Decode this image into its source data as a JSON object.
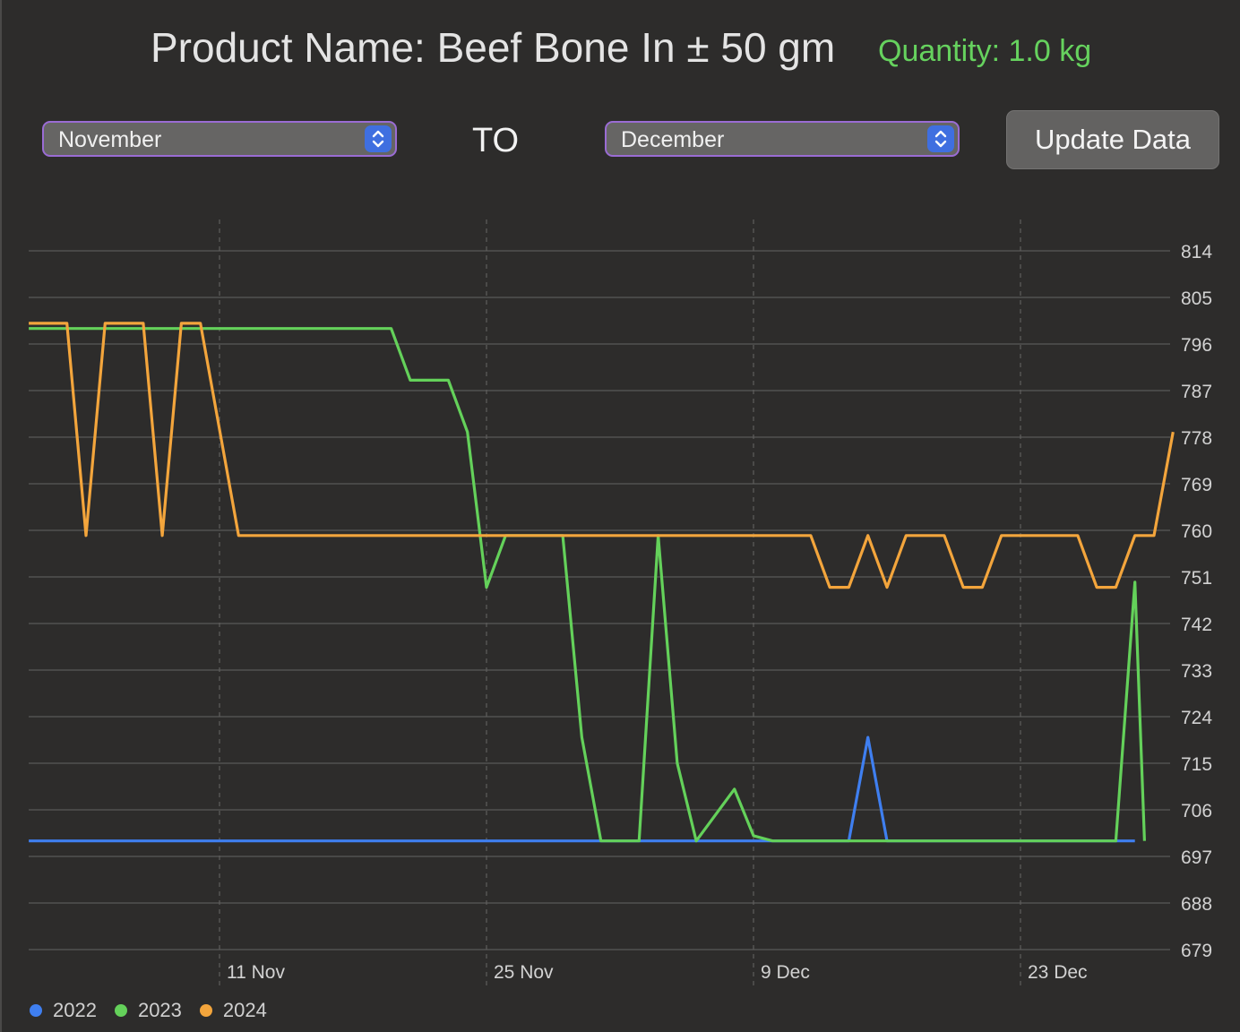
{
  "header": {
    "title": "Product Name: Beef Bone In ± 50 gm",
    "quantity": "Quantity: 1.0 kg"
  },
  "controls": {
    "from_month": "November",
    "to_label": "TO",
    "to_month": "December",
    "update_label": "Update Data"
  },
  "colors": {
    "2022": "#3f7ff0",
    "2023": "#64d15a",
    "2024": "#f3a53c",
    "accent": "#9a6cd4",
    "quantity": "#66d25e"
  },
  "chart_data": {
    "type": "line",
    "title": "",
    "xlabel": "",
    "ylabel": "",
    "x_ticks": [
      "11 Nov",
      "25 Nov",
      "9 Dec",
      "23 Dec"
    ],
    "y_ticks": [
      814,
      805,
      796,
      787,
      778,
      769,
      760,
      751,
      742,
      733,
      724,
      715,
      706,
      697,
      688,
      679
    ],
    "ylim": [
      679,
      814
    ],
    "xlim": [
      "1 Nov",
      "29 Dec"
    ],
    "grid": true,
    "legend": "bottom-left",
    "series": [
      {
        "name": "2022",
        "color": "#3f7ff0",
        "points": [
          [
            "1 Nov",
            700
          ],
          [
            "14 Dec",
            700
          ],
          [
            "15 Dec",
            720
          ],
          [
            "16 Dec",
            700
          ],
          [
            "29 Dec",
            700
          ]
        ]
      },
      {
        "name": "2023",
        "color": "#64d15a",
        "points": [
          [
            "1 Nov",
            799
          ],
          [
            "20 Nov",
            799
          ],
          [
            "21 Nov",
            789
          ],
          [
            "23 Nov",
            789
          ],
          [
            "24 Nov",
            779
          ],
          [
            "25 Nov",
            749
          ],
          [
            "26 Nov",
            759
          ],
          [
            "29 Nov",
            759
          ],
          [
            "30 Nov",
            720
          ],
          [
            "1 Dec",
            700
          ],
          [
            "3 Dec",
            700
          ],
          [
            "4 Dec",
            759
          ],
          [
            "5 Dec",
            715
          ],
          [
            "6 Dec",
            700
          ],
          [
            "7 Dec",
            705
          ],
          [
            "8 Dec",
            710
          ],
          [
            "9 Dec",
            701
          ],
          [
            "10 Dec",
            700
          ],
          [
            "28 Dec",
            700
          ],
          [
            "29 Dec",
            750
          ],
          [
            "29.5 Dec",
            700
          ]
        ]
      },
      {
        "name": "2024",
        "color": "#f3a53c",
        "points": [
          [
            "1 Nov",
            800
          ],
          [
            "3 Nov",
            800
          ],
          [
            "4 Nov",
            759
          ],
          [
            "5 Nov",
            800
          ],
          [
            "7 Nov",
            800
          ],
          [
            "8 Nov",
            759
          ],
          [
            "9 Nov",
            800
          ],
          [
            "10 Nov",
            800
          ],
          [
            "12 Nov",
            759
          ],
          [
            "12 Dec",
            759
          ],
          [
            "13 Dec",
            749
          ],
          [
            "14 Dec",
            749
          ],
          [
            "15 Dec",
            759
          ],
          [
            "16 Dec",
            749
          ],
          [
            "17 Dec",
            759
          ],
          [
            "19 Dec",
            759
          ],
          [
            "20 Dec",
            749
          ],
          [
            "21 Dec",
            749
          ],
          [
            "22 Dec",
            759
          ],
          [
            "26 Dec",
            759
          ],
          [
            "27 Dec",
            749
          ],
          [
            "28 Dec",
            749
          ],
          [
            "29 Dec",
            759
          ],
          [
            "30 Dec",
            759
          ],
          [
            "31 Dec",
            779
          ]
        ]
      }
    ]
  }
}
